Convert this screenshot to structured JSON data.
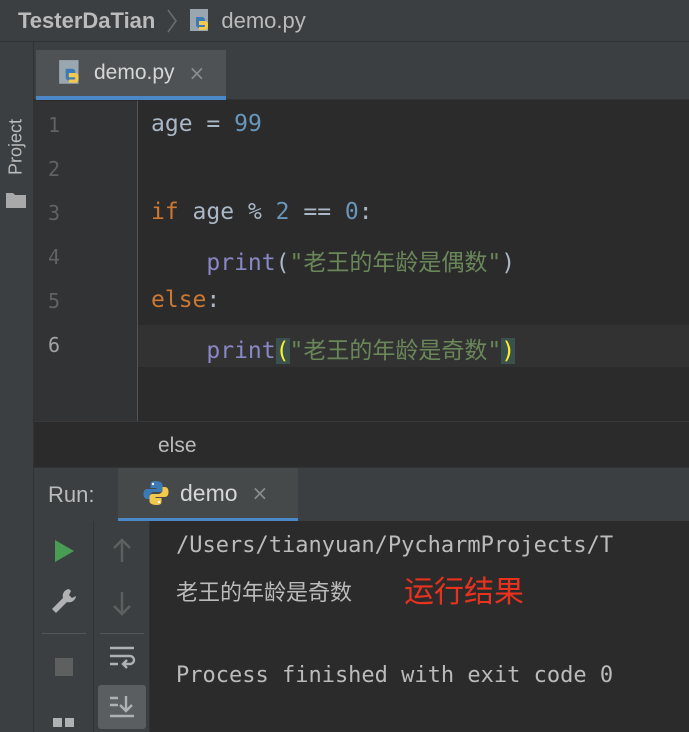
{
  "navbar": {
    "project": "TesterDaTian",
    "file": "demo.py"
  },
  "toolstrip": {
    "project_label": "Project"
  },
  "editor": {
    "tab_label": "demo.py",
    "tab_close": "×",
    "line_numbers": [
      "1",
      "2",
      "3",
      "4",
      "5",
      "6"
    ],
    "current_line": 6,
    "lines": [
      [
        {
          "t": "age = ",
          "c": "plain"
        },
        {
          "t": "99",
          "c": "num"
        }
      ],
      [],
      [
        {
          "t": "if",
          "c": "kw"
        },
        {
          "t": " age % ",
          "c": "plain"
        },
        {
          "t": "2",
          "c": "num"
        },
        {
          "t": " == ",
          "c": "plain"
        },
        {
          "t": "0",
          "c": "num"
        },
        {
          "t": ":",
          "c": "plain"
        }
      ],
      [
        {
          "t": "    ",
          "c": "plain"
        },
        {
          "t": "print",
          "c": "bi"
        },
        {
          "t": "(",
          "c": "plain"
        },
        {
          "t": "\"老王的年龄是偶数\"",
          "c": "str"
        },
        {
          "t": ")",
          "c": "plain"
        }
      ],
      [
        {
          "t": "else",
          "c": "kw"
        },
        {
          "t": ":",
          "c": "plain"
        }
      ],
      [
        {
          "t": "    ",
          "c": "plain"
        },
        {
          "t": "print",
          "c": "bi"
        },
        {
          "t": "(",
          "c": "brace"
        },
        {
          "t": "\"老王的年龄是奇数\"",
          "c": "str"
        },
        {
          "t": ")",
          "c": "brace"
        }
      ]
    ],
    "breadcrumb": "else"
  },
  "run": {
    "title": "Run:",
    "tab_label": "demo",
    "tab_close": "×",
    "console": {
      "path_line": "/Users/tianyuan/PycharmProjects/T",
      "output_line": "老王的年龄是奇数",
      "annotation": "运行结果",
      "exit_line": "Process finished with exit code 0"
    }
  },
  "colors": {
    "keyword": "#cc7832",
    "number": "#6897bb",
    "builtin": "#8888c6",
    "string": "#6a8759",
    "accent": "#4a88c7",
    "annotation": "#e8321e",
    "run_green": "#499c54"
  }
}
